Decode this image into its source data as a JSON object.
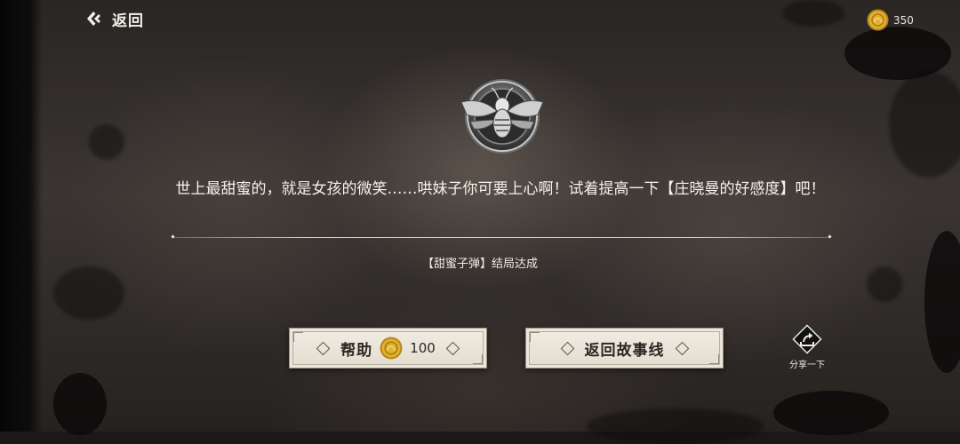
{
  "header": {
    "back_label": "返回",
    "currency_value": "350"
  },
  "main": {
    "message": "世上最甜蜜的，就是女孩的微笑……哄妹子你可要上心啊！试着提高一下【庄晓曼的好感度】吧！",
    "ending_text": "【甜蜜子弹】结局达成"
  },
  "actions": {
    "help_label": "帮助",
    "help_cost": "100",
    "storyline_label": "返回故事线",
    "share_label": "分享一下"
  },
  "icons": {
    "back": "chevron-left-icon",
    "coin": "coin-icon",
    "emblem": "bee-emblem-icon",
    "share": "share-icon"
  },
  "colors": {
    "button_bg": "#ece7dc",
    "coin": "#d9a826",
    "text_light": "#f4f1eb"
  }
}
